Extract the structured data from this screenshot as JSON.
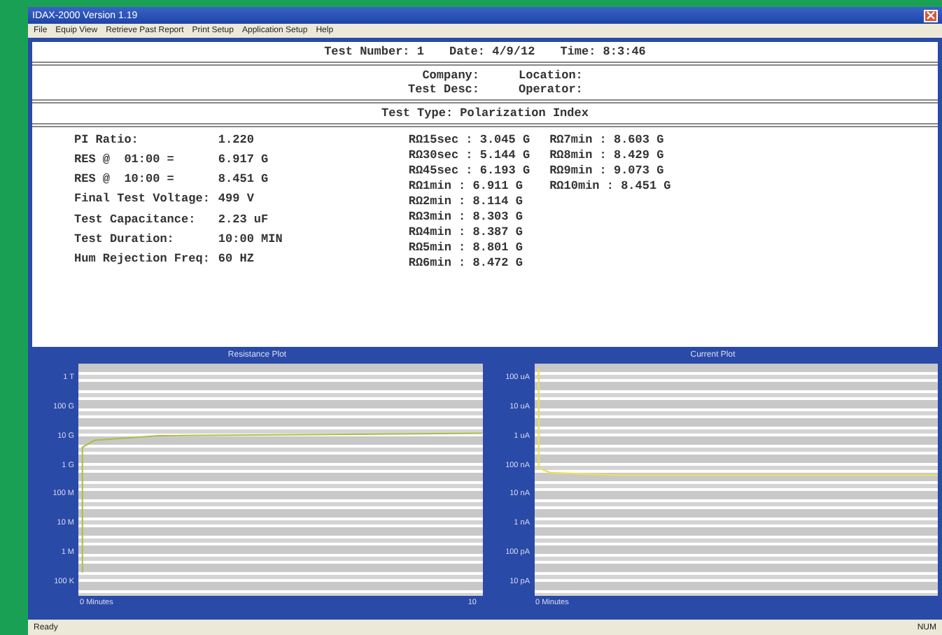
{
  "window": {
    "title": "IDAX-2000 Version 1.19"
  },
  "menu": [
    "File",
    "Equip View",
    "Retrieve Past Report",
    "Print Setup",
    "Application Setup",
    "Help"
  ],
  "header": {
    "test_number": "Test Number: 1",
    "date": "Date: 4/9/12",
    "time": "Time: 8:3:46"
  },
  "info": [
    {
      "label": "Company:"
    },
    {
      "label": "Location:"
    },
    {
      "label": "Test Desc:"
    },
    {
      "label": "Operator:"
    }
  ],
  "test_type": "Test Type: Polarization Index",
  "summary": [
    {
      "label": "PI Ratio:",
      "value": "1.220"
    },
    {
      "label": "RES @  01:00 =",
      "value": "6.917 G"
    },
    {
      "label": "RES @  10:00 =",
      "value": "8.451 G"
    },
    {
      "label": "Final Test Voltage:",
      "value": "499 V"
    },
    {
      "label": "Test Capacitance:",
      "value": "2.23 uF"
    },
    {
      "label": "Test Duration:",
      "value": "10:00 MIN"
    },
    {
      "label": "Hum Rejection Freq:",
      "value": "60 HZ"
    }
  ],
  "readings_col_1": [
    "RΩ15sec : 3.045 G",
    "RΩ30sec : 5.144 G",
    "RΩ45sec : 6.193 G",
    "RΩ1min : 6.911 G",
    "RΩ2min : 8.114 G",
    "RΩ3min : 8.303 G",
    "RΩ4min : 8.387 G",
    "RΩ5min : 8.801 G",
    "RΩ6min : 8.472 G"
  ],
  "readings_col_2": [
    "RΩ7min : 8.603 G",
    "RΩ8min : 8.429 G",
    "RΩ9min : 9.073 G",
    "RΩ10min : 8.451 G"
  ],
  "plots": [
    {
      "title": "Resistance Plot",
      "yticks": [
        "1 T",
        "100 G",
        "10 G",
        "1 G",
        "100 M",
        "10 M",
        "1 M",
        "100 K"
      ],
      "xstart": "0 Minutes",
      "xend": "10",
      "kind": "resistance"
    },
    {
      "title": "Current Plot",
      "yticks": [
        "100 uA",
        "10 uA",
        "1 uA",
        "100 nA",
        "10 nA",
        "1 nA",
        "100 pA",
        "10 pA"
      ],
      "xstart": "0 Minutes",
      "kind": "current"
    }
  ],
  "status_bar": {
    "left": "Ready",
    "right": "NUM"
  }
}
